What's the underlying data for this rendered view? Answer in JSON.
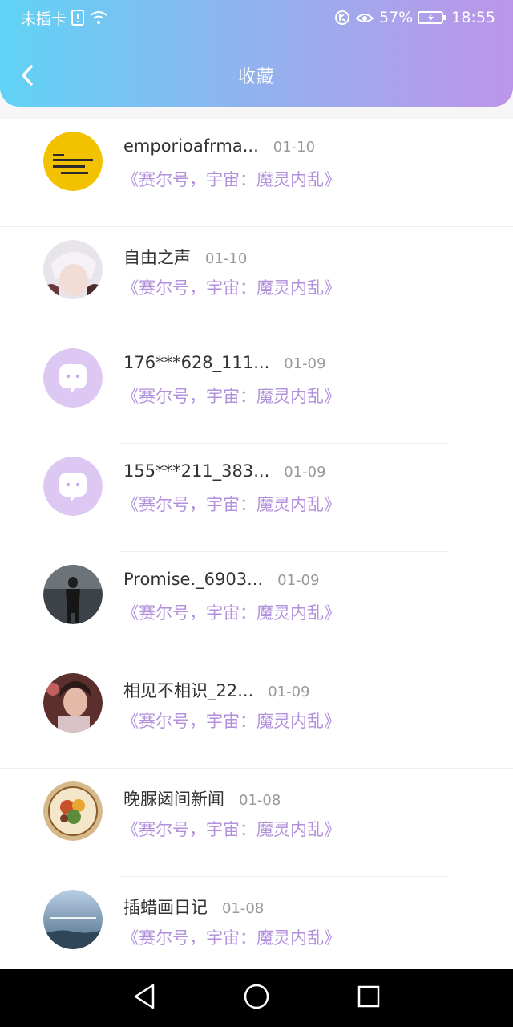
{
  "status_bar": {
    "carrier": "未插卡",
    "battery_percent": "57%",
    "time": "18:55"
  },
  "header": {
    "title": "收藏"
  },
  "favorites": [
    {
      "name": "emporioafrma...",
      "date": "01-10",
      "subtitle": "《赛尔号，宇宙：魔灵内乱》",
      "avatar": "yellow-sign-avatar"
    },
    {
      "name": "自由之声",
      "date": "01-10",
      "subtitle": "《赛尔号，宇宙：魔灵内乱》",
      "avatar": "anime-boy-avatar"
    },
    {
      "name": "176***628_111...",
      "date": "01-09",
      "subtitle": "《赛尔号，宇宙：魔灵内乱》",
      "avatar": "default-chat-avatar"
    },
    {
      "name": "155***211_383...",
      "date": "01-09",
      "subtitle": "《赛尔号，宇宙：魔灵内乱》",
      "avatar": "default-chat-avatar"
    },
    {
      "name": "Promise._6903...",
      "date": "01-09",
      "subtitle": "《赛尔号，宇宙：魔灵内乱》",
      "avatar": "dark-figure-avatar"
    },
    {
      "name": "相见不相识_22...",
      "date": "01-09",
      "subtitle": "《赛尔号，宇宙：魔灵内乱》",
      "avatar": "portrait-avatar"
    },
    {
      "name": "晚脲闼间新闻",
      "date": "01-08",
      "subtitle": "《赛尔号，宇宙：魔灵内乱》",
      "avatar": "food-plate-avatar"
    },
    {
      "name": "插蜡画日记",
      "date": "01-08",
      "subtitle": "《赛尔号，宇宙：魔灵内乱》",
      "avatar": "sky-avatar"
    }
  ],
  "colors": {
    "accent_purple": "#b290dc",
    "header_gradient_start": "#5fd3f5",
    "header_gradient_end": "#bd95e8"
  }
}
